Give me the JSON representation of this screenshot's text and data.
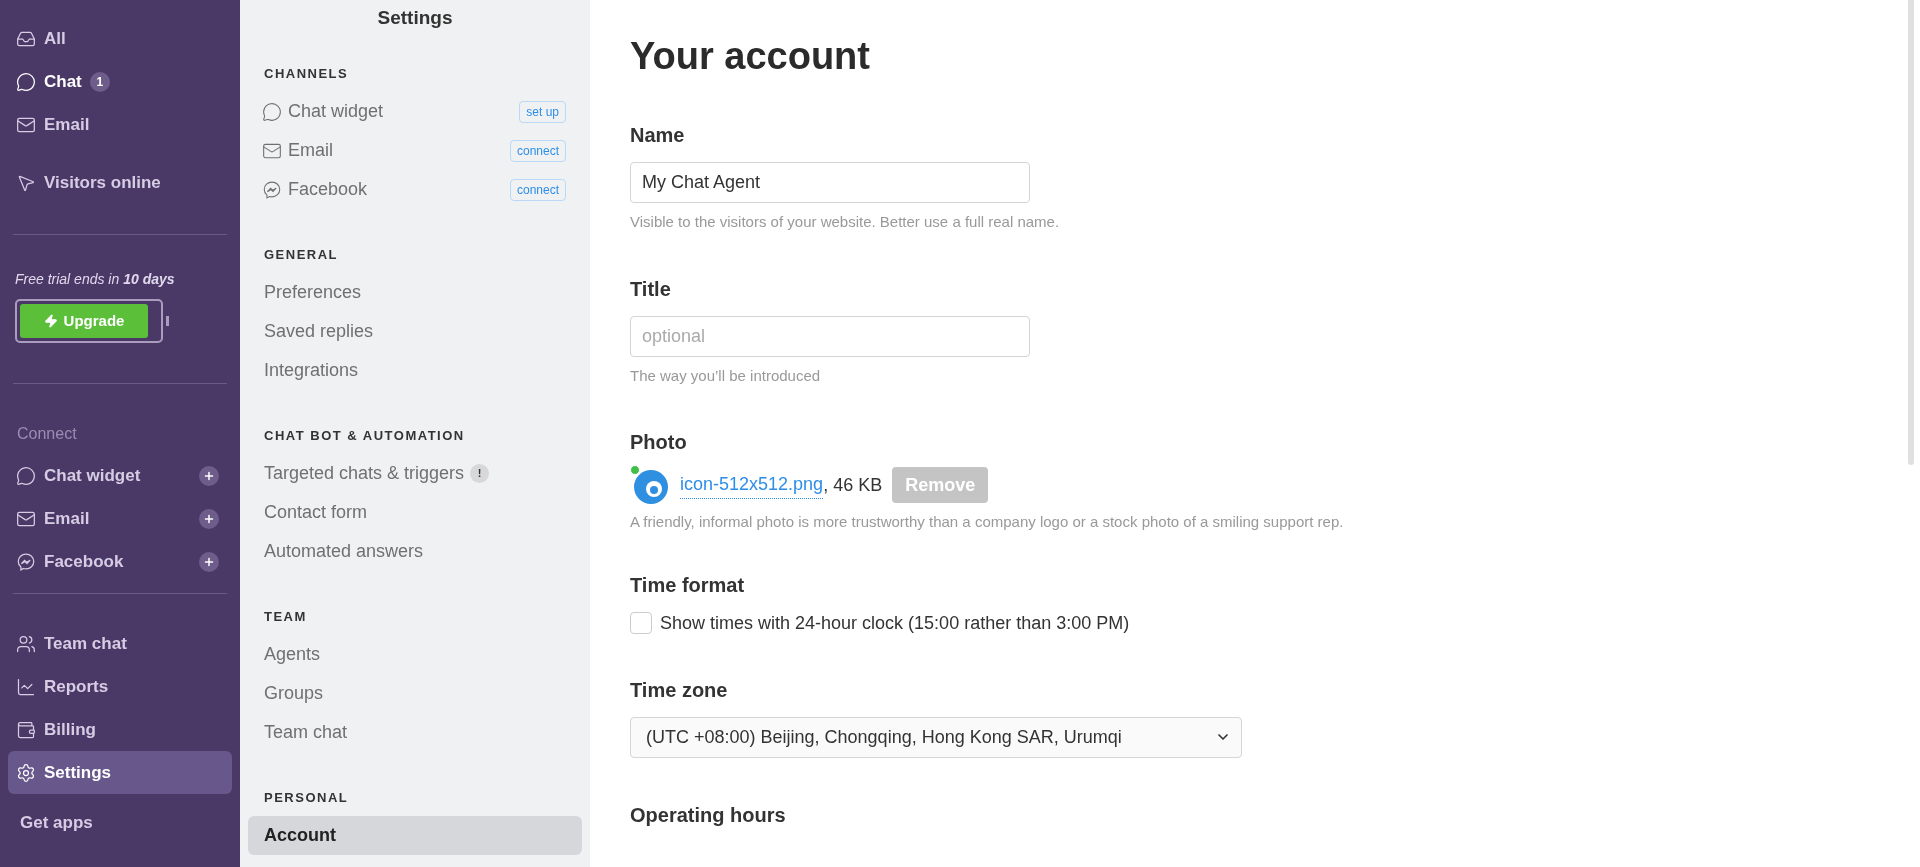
{
  "sidebar": {
    "conversations": [
      {
        "label": "All",
        "unread": false
      },
      {
        "label": "Chat",
        "badge": "1",
        "unread": true
      },
      {
        "label": "Email",
        "unread": false
      }
    ],
    "visitors": {
      "label": "Visitors online"
    },
    "trial": {
      "text": "Free trial ends in **10 days**",
      "button": "Upgrade"
    },
    "connect": {
      "heading": "Connect",
      "items": [
        {
          "label": "Chat widget"
        },
        {
          "label": "Email"
        },
        {
          "label": "Facebook"
        }
      ]
    },
    "tools": [
      {
        "label": "Team chat",
        "selected": false
      },
      {
        "label": "Reports",
        "selected": false
      },
      {
        "label": "Billing",
        "selected": false
      },
      {
        "label": "Settings",
        "selected": true
      }
    ],
    "get_apps": "Get apps"
  },
  "settings_menu": {
    "title": "Settings",
    "sections": [
      {
        "heading": "CHANNELS",
        "items": [
          {
            "label": "Chat widget",
            "action": "set up",
            "selected": false
          },
          {
            "label": "Email",
            "action": "connect",
            "selected": false
          },
          {
            "label": "Facebook",
            "action": "connect",
            "selected": false
          }
        ]
      },
      {
        "heading": "GENERAL",
        "items": [
          {
            "label": "Preferences",
            "selected": false
          },
          {
            "label": "Saved replies",
            "selected": false
          },
          {
            "label": "Integrations",
            "selected": false
          }
        ]
      },
      {
        "heading": "CHAT BOT & AUTOMATION",
        "items": [
          {
            "label": "Targeted chats & triggers",
            "alert": "!",
            "selected": false
          },
          {
            "label": "Contact form",
            "selected": false
          },
          {
            "label": "Automated answers",
            "selected": false
          }
        ]
      },
      {
        "heading": "TEAM",
        "items": [
          {
            "label": "Agents",
            "selected": false
          },
          {
            "label": "Groups",
            "selected": false
          },
          {
            "label": "Team chat",
            "selected": false
          }
        ]
      },
      {
        "heading": "PERSONAL",
        "items": [
          {
            "label": "Account",
            "selected": true
          }
        ]
      }
    ]
  },
  "account": {
    "title": "Your account",
    "name": {
      "label": "Name",
      "value": "My Chat Agent",
      "hint": "Visible to the visitors of your website. Better use a full real name."
    },
    "title_field": {
      "label": "Title",
      "placeholder": "optional",
      "hint": "The way you’ll be introduced"
    },
    "photo": {
      "label": "Photo",
      "file": "icon-512x512.png",
      "size": ", 46 KB",
      "button": "Remove",
      "hint": "A friendly, informal photo is more trustworthy than a company logo or a stock photo of a smiling support rep."
    },
    "time_format": {
      "label": "Time format",
      "option": "Show times with 24-hour clock (15:00 rather than 3:00 PM)",
      "checked": false
    },
    "time_zone": {
      "label": "Time zone",
      "value": "(UTC +08:00) Beijing, Chongqing, Hong Kong SAR, Urumqi"
    },
    "operating_hours": {
      "label": "Operating hours"
    }
  }
}
